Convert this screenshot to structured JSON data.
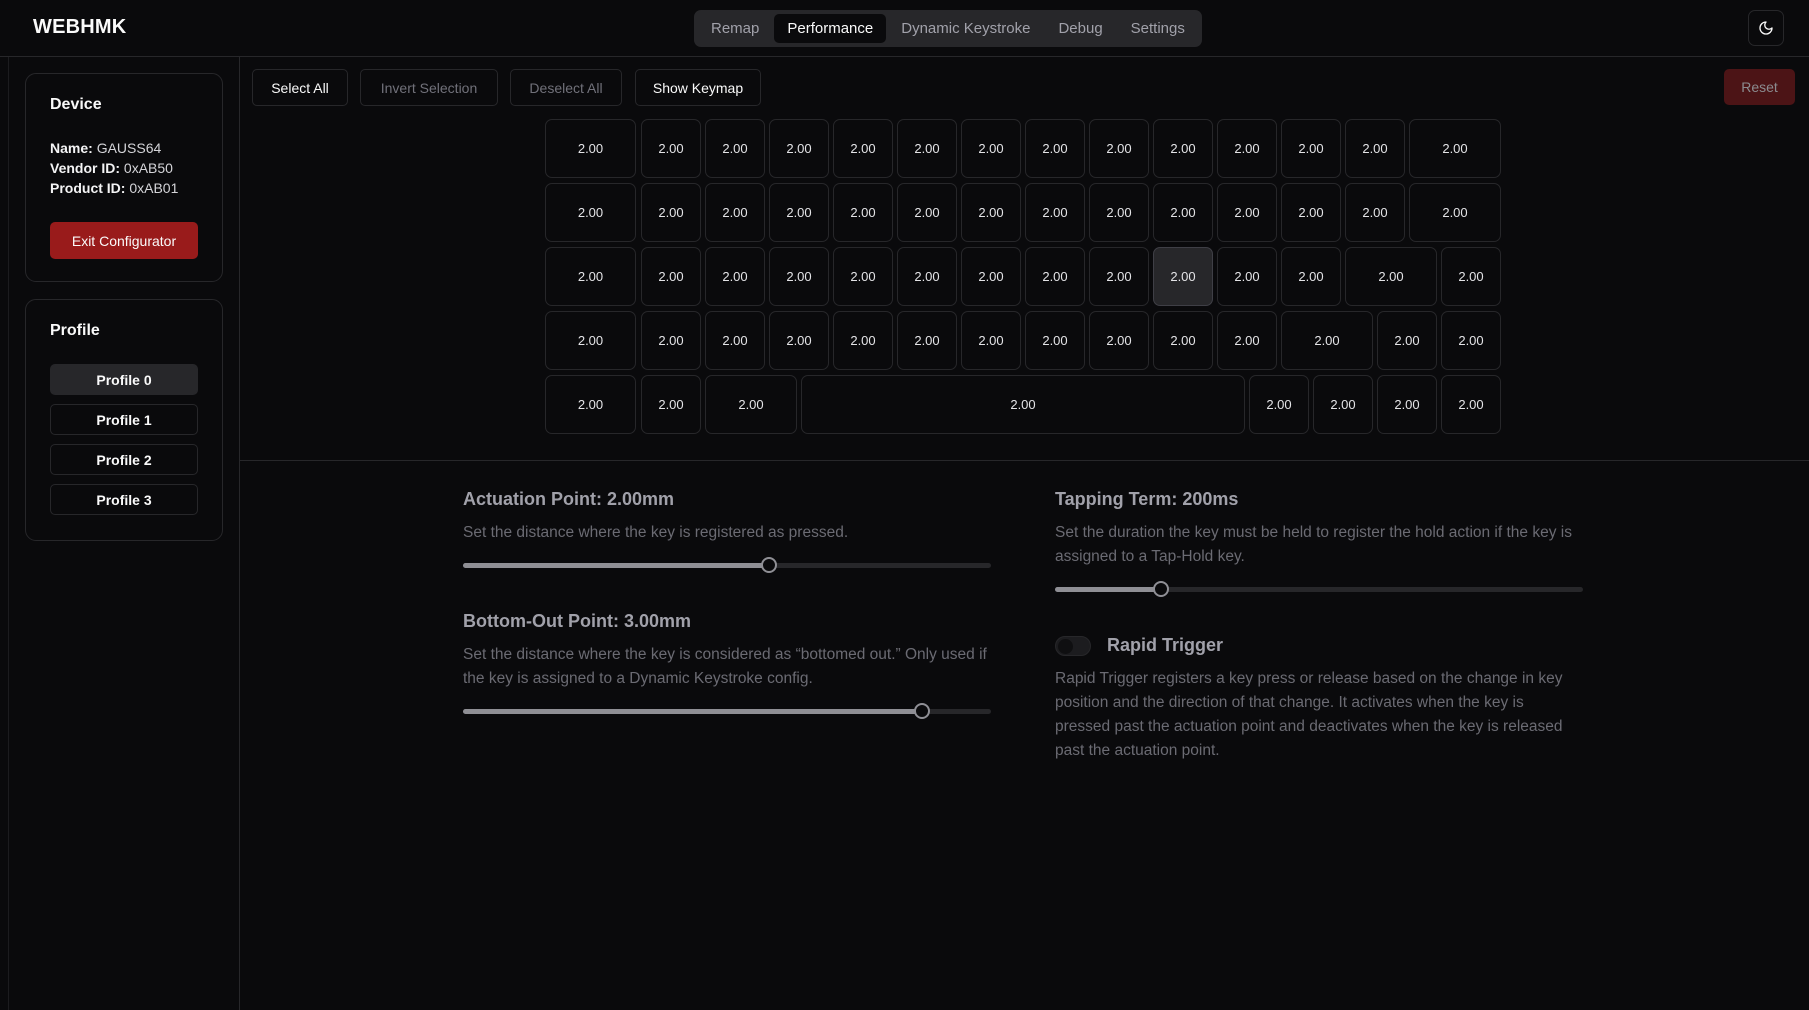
{
  "app": {
    "brand": "WEBHMK"
  },
  "nav": {
    "tabs": [
      {
        "label": "Remap",
        "active": false
      },
      {
        "label": "Performance",
        "active": true
      },
      {
        "label": "Dynamic Keystroke",
        "active": false
      },
      {
        "label": "Debug",
        "active": false
      },
      {
        "label": "Settings",
        "active": false
      }
    ],
    "theme_icon": "moon-icon"
  },
  "device": {
    "title": "Device",
    "name_label": "Name:",
    "name_value": "GAUSS64",
    "vendor_label": "Vendor ID:",
    "vendor_value": "0xAB50",
    "product_label": "Product ID:",
    "product_value": "0xAB01",
    "exit_label": "Exit Configurator"
  },
  "profile": {
    "title": "Profile",
    "items": [
      {
        "label": "Profile 0",
        "active": true
      },
      {
        "label": "Profile 1",
        "active": false
      },
      {
        "label": "Profile 2",
        "active": false
      },
      {
        "label": "Profile 3",
        "active": false
      }
    ]
  },
  "toolbar": {
    "select_all": "Select All",
    "invert_selection": "Invert Selection",
    "deselect_all": "Deselect All",
    "show_keymap": "Show Keymap",
    "reset": "Reset"
  },
  "keyboard": {
    "rows": [
      [
        "2.00",
        "2.00",
        "2.00",
        "2.00",
        "2.00",
        "2.00",
        "2.00",
        "2.00",
        "2.00",
        "2.00",
        "2.00",
        "2.00",
        "2.00",
        "2.00"
      ],
      [
        "2.00",
        "2.00",
        "2.00",
        "2.00",
        "2.00",
        "2.00",
        "2.00",
        "2.00",
        "2.00",
        "2.00",
        "2.00",
        "2.00",
        "2.00",
        "2.00"
      ],
      [
        "2.00",
        "2.00",
        "2.00",
        "2.00",
        "2.00",
        "2.00",
        "2.00",
        "2.00",
        "2.00",
        "2.00",
        "2.00",
        "2.00",
        "2.00",
        "2.00"
      ],
      [
        "2.00",
        "2.00",
        "2.00",
        "2.00",
        "2.00",
        "2.00",
        "2.00",
        "2.00",
        "2.00",
        "2.00",
        "2.00",
        "2.00",
        "2.00",
        "2.00"
      ],
      [
        "2.00",
        "2.00",
        "2.00",
        "2.00",
        "2.00",
        "2.00",
        "2.00",
        "2.00"
      ]
    ],
    "selected_key": {
      "row": 2,
      "col": 9
    }
  },
  "settings": {
    "actuation": {
      "title": "Actuation Point: 2.00mm",
      "description": "Set the distance where the key is registered as pressed.",
      "value_fraction": 0.58
    },
    "bottom_out": {
      "title": "Bottom-Out Point: 3.00mm",
      "description": "Set the distance where the key is considered as “bottomed out.” Only used if the key is assigned to a Dynamic Keystroke config.",
      "value_fraction": 0.87
    },
    "tapping_term": {
      "title": "Tapping Term: 200ms",
      "description": "Set the duration the key must be held to register the hold action if the key is assigned to a Tap-Hold key.",
      "value_fraction": 0.2
    },
    "rapid_trigger": {
      "title": "Rapid Trigger",
      "enabled": false,
      "description": "Rapid Trigger registers a key press or release based on the change in key position and the direction of that change. It activates when the key is pressed past the actuation point and deactivates when the key is released past the actuation point."
    }
  }
}
